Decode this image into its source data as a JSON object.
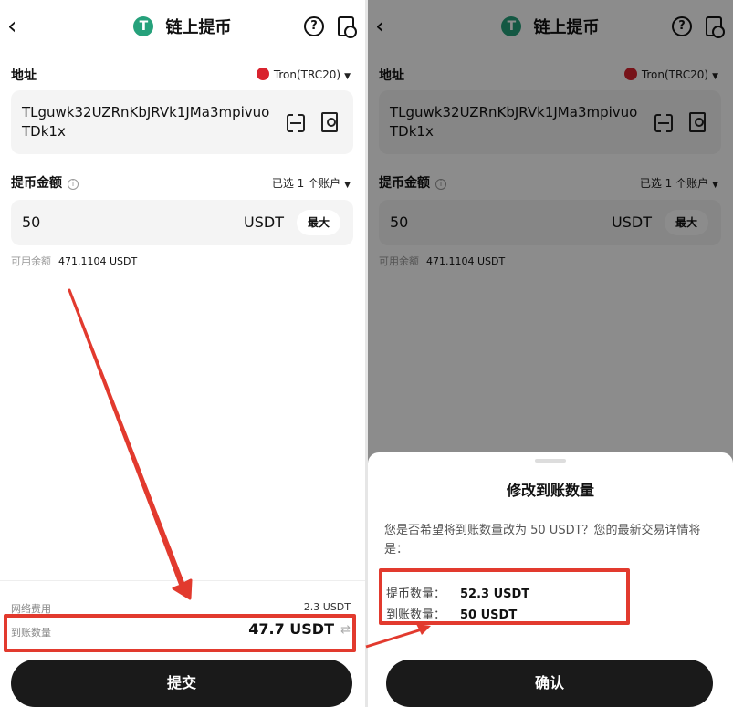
{
  "left": {
    "header": {
      "back": "‹",
      "coin_glyph": "T",
      "title": "链上提币",
      "help": "?"
    },
    "address": {
      "label": "地址",
      "network": "Tron(TRC20)",
      "value": "TLguwk32UZRnKbJRVk1JMa3mpivuoTDk1x"
    },
    "amount": {
      "label": "提币金额",
      "info": "i",
      "account_select": "已选 1 个账户",
      "value": "50",
      "unit": "USDT",
      "max": "最大"
    },
    "available": {
      "label": "可用余额",
      "value": "471.1104 USDT"
    },
    "footer": {
      "fee_label": "网络费用",
      "fee_value": "2.3 USDT",
      "receive_label": "到账数量",
      "receive_value": "47.7 USDT",
      "submit": "提交"
    }
  },
  "right": {
    "header": {
      "back": "‹",
      "coin_glyph": "T",
      "title": "链上提币",
      "help": "?"
    },
    "address": {
      "label": "地址",
      "network": "Tron(TRC20)",
      "value": "TLguwk32UZRnKbJRVk1JMa3mpivuoTDk1x"
    },
    "amount": {
      "label": "提币金额",
      "info": "i",
      "account_select": "已选 1 个账户",
      "value": "50",
      "unit": "USDT",
      "max": "最大"
    },
    "available": {
      "label": "可用余额",
      "value": "471.1104 USDT"
    },
    "sheet": {
      "title": "修改到账数量",
      "message": "您是否希望将到账数量改为 50 USDT？您的最新交易详情将是：",
      "withdraw_label": "提币数量：",
      "withdraw_value": "52.3 USDT",
      "receive_label": "到账数量：",
      "receive_value": "50 USDT",
      "confirm": "确认"
    }
  },
  "colors": {
    "highlight": "#e23a2e",
    "tether": "#26a17b",
    "tron": "#d9232e",
    "button": "#1a1a1a"
  },
  "icons": [
    "back-chevron-icon",
    "tether-icon",
    "help-icon",
    "history-icon",
    "tron-icon",
    "scan-icon",
    "address-book-icon",
    "info-icon",
    "swap-icon"
  ]
}
